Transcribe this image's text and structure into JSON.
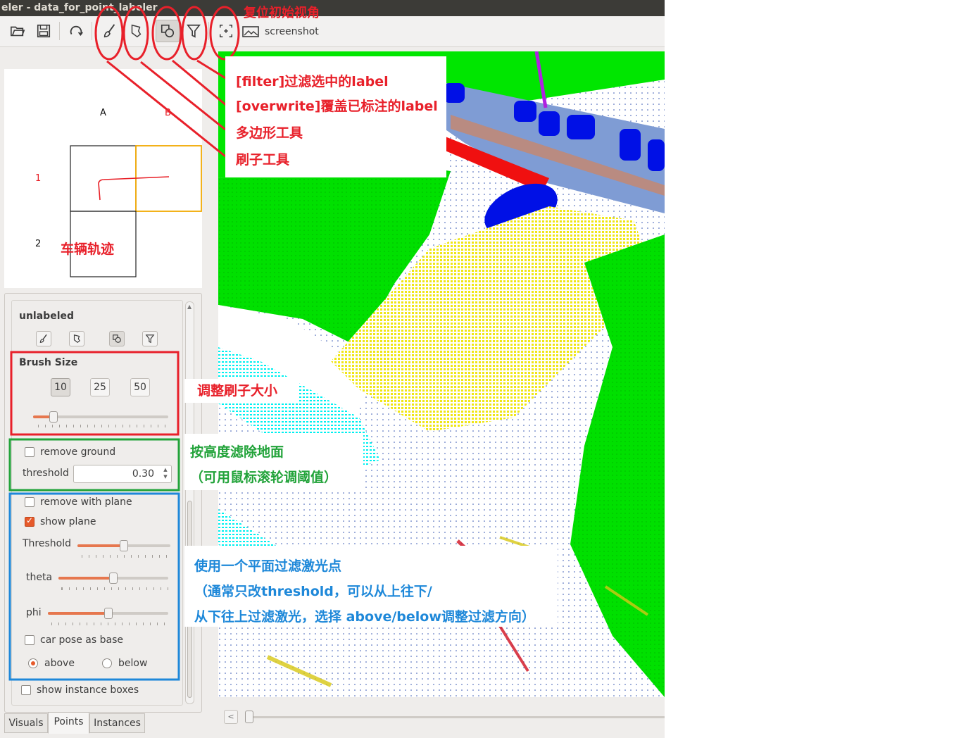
{
  "window": {
    "title": "eler - data_for_point_labeler"
  },
  "toolbar": {
    "buttons": [
      {
        "name": "open-icon"
      },
      {
        "name": "save-icon"
      },
      {
        "name": "reload-icon"
      },
      {
        "name": "brush-icon"
      },
      {
        "name": "polygon-icon"
      },
      {
        "name": "overwrite-icon"
      },
      {
        "name": "filter-icon"
      },
      {
        "name": "reset-view-icon"
      },
      {
        "name": "screenshot-icon"
      }
    ],
    "screenshot_label": "screenshot"
  },
  "trajectory": {
    "col_a": "A",
    "col_b": "B",
    "row_1": "1",
    "row_2": "2",
    "note": "车辆轨迹"
  },
  "panel": {
    "label_name": "unlabeled",
    "brush_size_title": "Brush Size",
    "brush_sizes": [
      "10",
      "25",
      "50"
    ],
    "brush_size_selected": "10",
    "brush_slider_value": 0.15,
    "remove_ground": "remove ground",
    "threshold_label": "threshold",
    "threshold_value": "0.30",
    "remove_with_plane": "remove with plane",
    "show_plane": "show plane",
    "plane_threshold_label": "Threshold",
    "plane_threshold_value": 0.5,
    "theta_label": "theta",
    "theta_value": 0.5,
    "phi_label": "phi",
    "phi_value": 0.5,
    "car_pose_as_base": "car pose as base",
    "above": "above",
    "below": "below",
    "show_instance_boxes": "show instance boxes"
  },
  "tabs": [
    "Visuals",
    "Points",
    "Instances"
  ],
  "tabs_active": "Points",
  "annotations": {
    "reset_view": "复位初始视角",
    "filter": "[filter]过滤选中的label",
    "overwrite": "[overwrite]覆盖已标注的label",
    "polygon": "多边形工具",
    "brush": "刷子工具",
    "brush_size": "调整刷子大小",
    "ground_line1": "按高度滤除地面",
    "ground_line2": "（可用鼠标滚轮调阈值）",
    "plane_line1": "使用一个平面过滤激光点",
    "plane_line2": "（通常只改threshold，可以从上往下/",
    "plane_line3": "从下往上过滤激光，选择 above/below调整过滤方向）"
  },
  "colors": {
    "annotation_red": "#e8202a",
    "annotation_green": "#22a33a",
    "annotation_blue": "#1e88d9",
    "accent_orange": "#e65a2b",
    "vegetation": "#00e600",
    "road": "#7f9cd4",
    "car": "#0010e6",
    "sidewalk": "#f0e614",
    "terrain_cyan": "#00ffff"
  }
}
